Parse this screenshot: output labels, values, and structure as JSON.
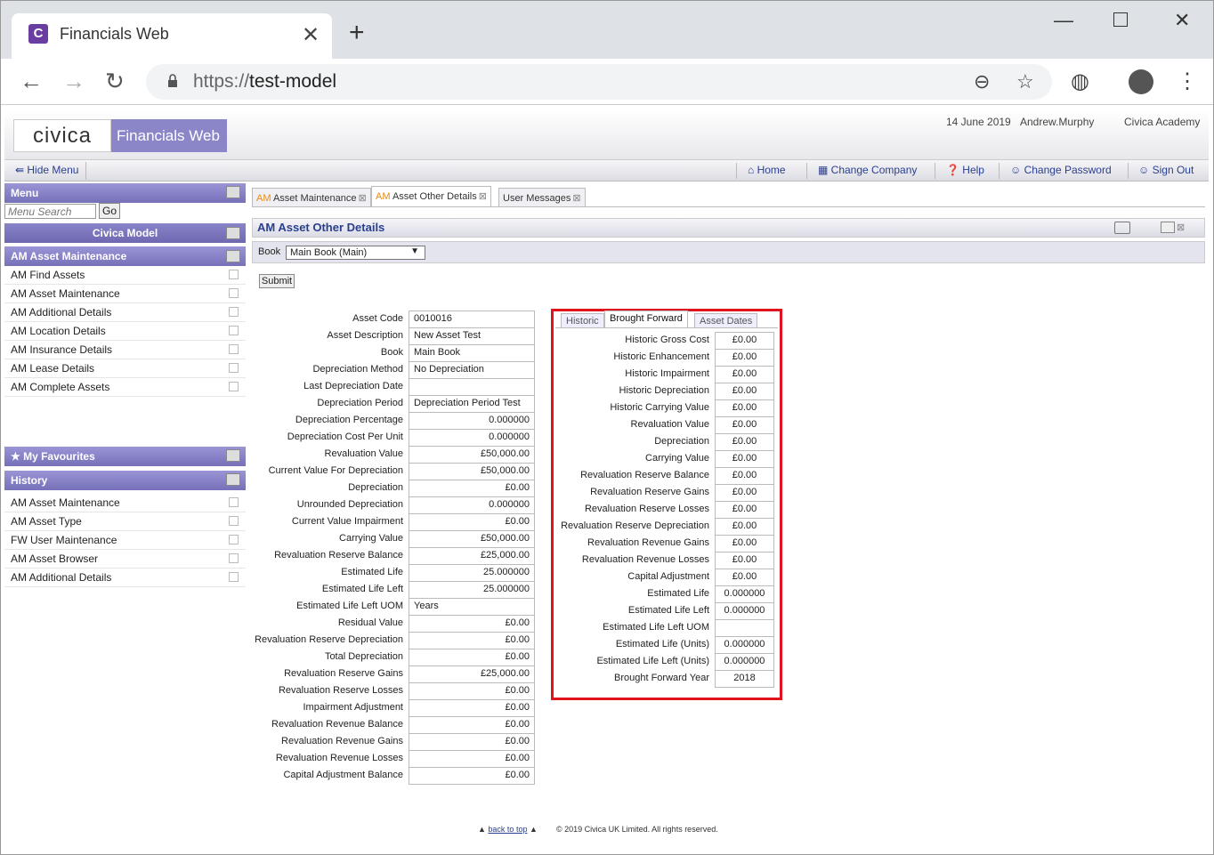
{
  "browser": {
    "tab_title": "Financials Web",
    "favicon_letter": "C",
    "url_scheme": "https://",
    "url_host": "test-model"
  },
  "header": {
    "logo": "civica",
    "product": "Financials Web",
    "date": "14 June 2019",
    "user": "Andrew.Murphy",
    "company": "Civica Academy"
  },
  "navbar": {
    "hide_menu": "Hide Menu",
    "home": "Home",
    "change_company": "Change Company",
    "help": "Help",
    "change_password": "Change Password",
    "sign_out": "Sign Out"
  },
  "sidebar": {
    "menu_title": "Menu",
    "search_placeholder": "Menu Search",
    "go_label": "Go",
    "model_title": "Civica Model",
    "section_title": "AM Asset Maintenance",
    "items": [
      "AM Find Assets",
      "AM Asset Maintenance",
      "AM Additional Details",
      "AM Location Details",
      "AM Insurance Details",
      "AM Lease Details",
      "AM Complete Assets"
    ],
    "favourites_title": "My Favourites",
    "history_title": "History",
    "history": [
      "AM Asset Maintenance",
      "AM Asset Type",
      "FW User Maintenance",
      "AM Asset Browser",
      "AM Additional Details"
    ]
  },
  "content_tabs": [
    {
      "prefix": "AM",
      "label": "Asset Maintenance"
    },
    {
      "prefix": "AM",
      "label": "Asset Other Details"
    },
    {
      "prefix": "",
      "label": "User Messages"
    }
  ],
  "panel": {
    "title": "AM Asset Other Details",
    "book_label": "Book",
    "book_value": "Main Book (Main)",
    "submit": "Submit"
  },
  "details": [
    {
      "label": "Asset Code",
      "value": "0010016",
      "align": "left"
    },
    {
      "label": "Asset Description",
      "value": "New Asset Test",
      "align": "left"
    },
    {
      "label": "Book",
      "value": "Main Book",
      "align": "left"
    },
    {
      "label": "Depreciation Method",
      "value": "No Depreciation",
      "align": "left"
    },
    {
      "label": "Last Depreciation Date",
      "value": "",
      "align": "left"
    },
    {
      "label": "Depreciation Period",
      "value": "Depreciation Period Test",
      "align": "left"
    },
    {
      "label": "Depreciation Percentage",
      "value": "0.000000",
      "align": "right"
    },
    {
      "label": "Depreciation Cost Per Unit",
      "value": "0.000000",
      "align": "right"
    },
    {
      "label": "Revaluation Value",
      "value": "£50,000.00",
      "align": "right"
    },
    {
      "label": "Current Value For Depreciation",
      "value": "£50,000.00",
      "align": "right"
    },
    {
      "label": "Depreciation",
      "value": "£0.00",
      "align": "right"
    },
    {
      "label": "Unrounded Depreciation",
      "value": "0.000000",
      "align": "right"
    },
    {
      "label": "Current Value Impairment",
      "value": "£0.00",
      "align": "right"
    },
    {
      "label": "Carrying Value",
      "value": "£50,000.00",
      "align": "right"
    },
    {
      "label": "Revaluation Reserve Balance",
      "value": "£25,000.00",
      "align": "right"
    },
    {
      "label": "Estimated Life",
      "value": "25.000000",
      "align": "right"
    },
    {
      "label": "Estimated Life Left",
      "value": "25.000000",
      "align": "right"
    },
    {
      "label": "Estimated Life Left UOM",
      "value": "Years",
      "align": "left"
    },
    {
      "label": "Residual Value",
      "value": "£0.00",
      "align": "right"
    },
    {
      "label": "Revaluation Reserve Depreciation",
      "value": "£0.00",
      "align": "right"
    },
    {
      "label": "Total Depreciation",
      "value": "£0.00",
      "align": "right"
    },
    {
      "label": "Revaluation Reserve Gains",
      "value": "£25,000.00",
      "align": "right"
    },
    {
      "label": "Revaluation Reserve Losses",
      "value": "£0.00",
      "align": "right"
    },
    {
      "label": "Impairment Adjustment",
      "value": "£0.00",
      "align": "right"
    },
    {
      "label": "Revaluation Revenue Balance",
      "value": "£0.00",
      "align": "right"
    },
    {
      "label": "Revaluation Revenue Gains",
      "value": "£0.00",
      "align": "right"
    },
    {
      "label": "Revaluation Revenue Losses",
      "value": "£0.00",
      "align": "right"
    },
    {
      "label": "Capital Adjustment Balance",
      "value": "£0.00",
      "align": "right"
    }
  ],
  "bf_tabs": [
    "Historic",
    "Brought Forward",
    "Asset Dates"
  ],
  "brought_forward": [
    {
      "label": "Historic Gross Cost",
      "value": "£0.00"
    },
    {
      "label": "Historic Enhancement",
      "value": "£0.00"
    },
    {
      "label": "Historic Impairment",
      "value": "£0.00"
    },
    {
      "label": "Historic Depreciation",
      "value": "£0.00"
    },
    {
      "label": "Historic Carrying Value",
      "value": "£0.00"
    },
    {
      "label": "Revaluation Value",
      "value": "£0.00"
    },
    {
      "label": "Depreciation",
      "value": "£0.00"
    },
    {
      "label": "Carrying Value",
      "value": "£0.00"
    },
    {
      "label": "Revaluation Reserve Balance",
      "value": "£0.00"
    },
    {
      "label": "Revaluation Reserve Gains",
      "value": "£0.00"
    },
    {
      "label": "Revaluation Reserve Losses",
      "value": "£0.00"
    },
    {
      "label": "Revaluation Reserve Depreciation",
      "value": "£0.00"
    },
    {
      "label": "Revaluation Revenue Gains",
      "value": "£0.00"
    },
    {
      "label": "Revaluation Revenue Losses",
      "value": "£0.00"
    },
    {
      "label": "Capital Adjustment",
      "value": "£0.00"
    },
    {
      "label": "Estimated Life",
      "value": "0.000000"
    },
    {
      "label": "Estimated Life Left",
      "value": "0.000000"
    },
    {
      "label": "Estimated Life Left UOM",
      "value": ""
    },
    {
      "label": "Estimated Life (Units)",
      "value": "0.000000"
    },
    {
      "label": "Estimated Life Left (Units)",
      "value": "0.000000"
    },
    {
      "label": "Brought Forward Year",
      "value": "2018"
    }
  ],
  "footer": {
    "back_to_top": "back to top",
    "copyright": "© 2019 Civica UK Limited. All rights reserved."
  },
  "colors": {
    "accent": "#8b86c7",
    "highlight": "#e0141e",
    "link": "#2a3f8f"
  }
}
